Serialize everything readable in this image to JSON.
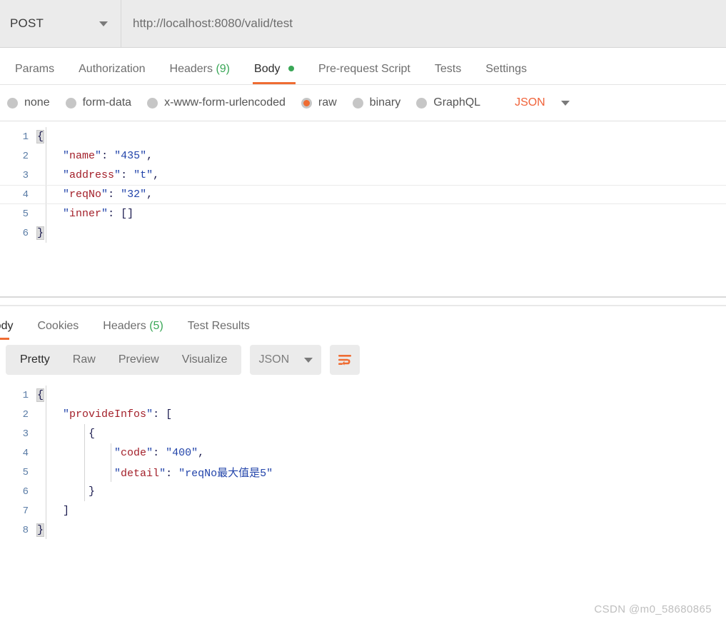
{
  "request": {
    "method": "POST",
    "url": "http://localhost:8080/valid/test",
    "tabs": [
      {
        "label": "Params",
        "active": false
      },
      {
        "label": "Authorization",
        "active": false
      },
      {
        "label": "Headers",
        "count": "(9)",
        "active": false
      },
      {
        "label": "Body",
        "active": true,
        "has_dot": true
      },
      {
        "label": "Pre-request Script",
        "active": false
      },
      {
        "label": "Tests",
        "active": false
      },
      {
        "label": "Settings",
        "active": false
      }
    ],
    "body_types": [
      {
        "label": "none",
        "selected": false
      },
      {
        "label": "form-data",
        "selected": false
      },
      {
        "label": "x-www-form-urlencoded",
        "selected": false
      },
      {
        "label": "raw",
        "selected": true
      },
      {
        "label": "binary",
        "selected": false
      },
      {
        "label": "GraphQL",
        "selected": false
      }
    ],
    "language": "JSON",
    "body_lines": [
      {
        "n": "1",
        "text": "{"
      },
      {
        "n": "2",
        "text": "    \"name\": \"435\","
      },
      {
        "n": "3",
        "text": "    \"address\": \"t\","
      },
      {
        "n": "4",
        "text": "    \"reqNo\": \"32\","
      },
      {
        "n": "5",
        "text": "    \"inner\": []"
      },
      {
        "n": "6",
        "text": "}"
      }
    ]
  },
  "response": {
    "tabs": [
      {
        "label": "Body",
        "active": true
      },
      {
        "label": "Cookies",
        "active": false
      },
      {
        "label": "Headers",
        "count": "(5)",
        "active": false
      },
      {
        "label": "Test Results",
        "active": false
      }
    ],
    "view_modes": [
      {
        "label": "Pretty",
        "active": true
      },
      {
        "label": "Raw",
        "active": false
      },
      {
        "label": "Preview",
        "active": false
      },
      {
        "label": "Visualize",
        "active": false
      }
    ],
    "format": "JSON",
    "wrap_icon": "word-wrap-icon",
    "body_lines": [
      {
        "n": "1",
        "text": "{"
      },
      {
        "n": "2",
        "text": "    \"provideInfos\": ["
      },
      {
        "n": "3",
        "text": "        {"
      },
      {
        "n": "4",
        "text": "            \"code\": \"400\","
      },
      {
        "n": "5",
        "text": "            \"detail\": \"reqNo最大值是5\""
      },
      {
        "n": "6",
        "text": "        }"
      },
      {
        "n": "7",
        "text": "    ]"
      },
      {
        "n": "8",
        "text": "}"
      }
    ]
  },
  "watermark": "CSDN @m0_58680865",
  "colors": {
    "accent": "#ef6c33",
    "success": "#3aa757",
    "key": "#a3202a",
    "string": "#2244aa",
    "punct": "#1a1a4e",
    "toolbar_bg": "#ebebeb"
  }
}
